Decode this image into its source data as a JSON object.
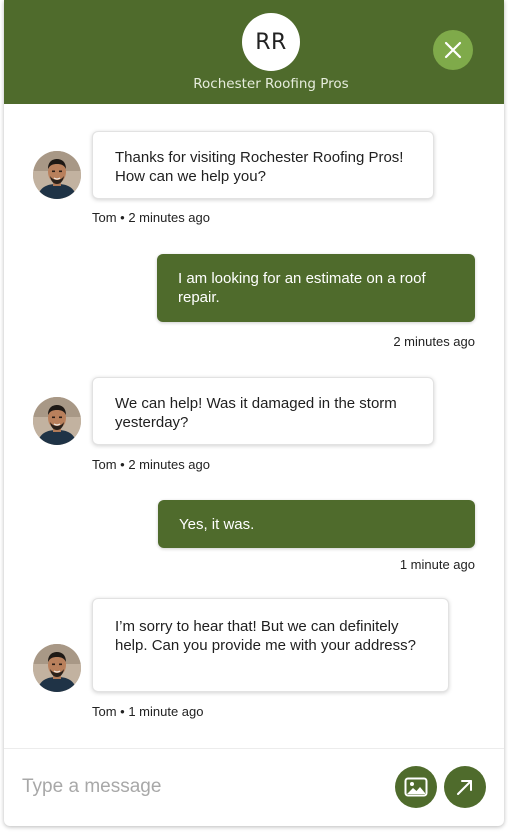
{
  "header": {
    "logo_initials": "RR",
    "company_name": "Rochester Roofing Pros"
  },
  "composer": {
    "placeholder": "Type a message"
  },
  "messages": [
    {
      "sender": "bot",
      "text": "Thanks for visiting Rochester Roofing Pros! How can we help you?",
      "meta": "Tom • 2 minutes ago"
    },
    {
      "sender": "user",
      "text": "I am looking for an estimate on a roof repair.",
      "meta": "2 minutes ago"
    },
    {
      "sender": "bot",
      "text": "We can help! Was it damaged in the storm yesterday?",
      "meta": "Tom • 2 minutes ago"
    },
    {
      "sender": "user",
      "text": "Yes, it was.",
      "meta": "1 minute ago"
    },
    {
      "sender": "bot",
      "text": "I’m sorry to hear that! But we can definitely help. Can you provide me with your address?",
      "meta": "Tom • 1 minute ago"
    }
  ],
  "colors": {
    "brand_green": "#4f6b2c",
    "close_button_green": "#7faa4a"
  },
  "icons": {
    "close": "close-icon",
    "image_upload": "image-icon",
    "send": "send-arrow-icon"
  }
}
